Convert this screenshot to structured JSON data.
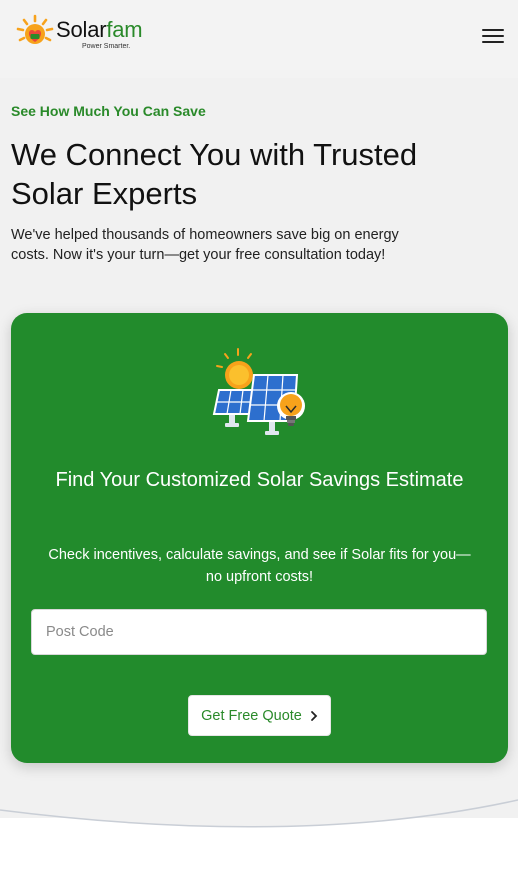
{
  "header": {
    "logo": {
      "word_1": "Solar",
      "word_2": "fam",
      "tagline": "Power Smarter."
    },
    "menu_icon": "hamburger-menu-icon"
  },
  "hero": {
    "eyebrow": "See How Much You Can Save",
    "headline": "We Connect You with Trusted Solar Experts",
    "subtext": "We've helped thousands of homeowners save big on energy costs. Now it's your turn—get your free consultation today!"
  },
  "card": {
    "illustration_icon": "solar-panels-lightbulb-icon",
    "title": "Find Your Customized Solar Savings Estimate",
    "description": "Check incentives, calculate savings, and see if Solar fits for you—no upfront costs!",
    "postcode": {
      "placeholder": "Post Code",
      "value": ""
    },
    "cta_label": "Get Free Quote",
    "cta_icon": "chevron-right-icon"
  },
  "colors": {
    "brand_green": "#228b2c",
    "accent_text_green": "#2a8a2a",
    "page_bg": "#f1f1f1",
    "sun_orange": "#f7a21b",
    "panel_blue": "#2d6fce"
  }
}
